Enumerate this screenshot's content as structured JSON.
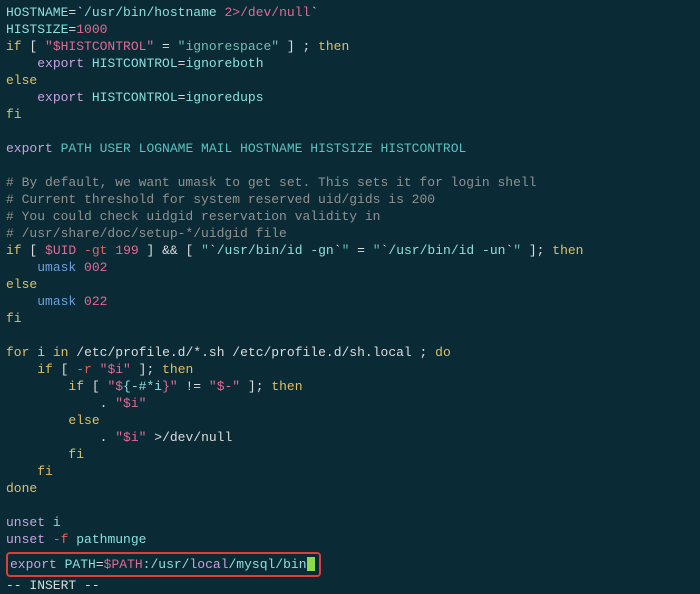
{
  "l1_hostname": "HOSTNAME",
  "l1_eq": "=",
  "l1_bq": "`",
  "l1_path": "/usr/bin/hostname ",
  "l1_dev": "2>/dev/null",
  "l1_bq2": "`",
  "l2_histsize": "HISTSIZE",
  "l2_eq": "=",
  "l2_val": "1000",
  "l3_if": "if",
  "l3_br1": " [ ",
  "l3_var": "\"$HISTCONTROL\"",
  "l3_eq": " = ",
  "l3_str": "\"ignorespace\"",
  "l3_br2": " ] ; ",
  "l3_then": "then",
  "l4_pad": "    ",
  "l4_export": "export",
  "l4_sp": " ",
  "l4_var": "HISTCONTROL",
  "l4_eq": "=",
  "l4_val": "ignoreboth",
  "l5_else": "else",
  "l6_pad": "    ",
  "l6_export": "export",
  "l6_sp": " ",
  "l6_var": "HISTCONTROL",
  "l6_eq": "=",
  "l6_val": "ignoredups",
  "l7_fi": "fi",
  "l9_export": "export",
  "l9_sp": " ",
  "l9_list": "PATH USER LOGNAME MAIL HOSTNAME HISTSIZE HISTCONTROL",
  "c1": "# By default, we want umask to get set. This sets it for login shell",
  "c2": "# Current threshold for system reserved uid/gids is 200",
  "c3": "# You could check uidgid reservation validity in",
  "c4": "# /usr/share/doc/setup-*/uidgid file",
  "u1_if": "if",
  "u1_br1": " [ ",
  "u1_uid": "$UID",
  "u1_sp": " ",
  "u1_gt": "-gt",
  "u1_sp2": " ",
  "u1_num": "199",
  "u1_br2": " ] ",
  "u1_amp": "&&",
  "u1_br3": " [ ",
  "u1_q1": "\"",
  "u1_bq1": "`",
  "u1_cmd1": "/usr/bin/id -gn",
  "u1_bq2": "`",
  "u1_q2": "\"",
  "u1_eq": " = ",
  "u1_q3": "\"",
  "u1_bq3": "`",
  "u1_cmd2": "/usr/bin/id -un",
  "u1_bq4": "`",
  "u1_q4": "\"",
  "u1_br4": " ]; ",
  "u1_then": "then",
  "u2_pad": "    ",
  "u2_umask": "umask",
  "u2_sp": " ",
  "u2_val": "002",
  "u3_else": "else",
  "u4_pad": "    ",
  "u4_umask": "umask",
  "u4_sp": " ",
  "u4_val": "022",
  "u5_fi": "fi",
  "f1_for": "for",
  "f1_sp": " ",
  "f1_i": "i",
  "f1_sp2": " ",
  "f1_in": "in",
  "f1_sp3": " ",
  "f1_paths": "/etc/profile.d/*.sh /etc/profile.d/sh.local",
  "f1_sp4": " ; ",
  "f1_do": "do",
  "f2_pad": "    ",
  "f2_if": "if",
  "f2_br1": " [ ",
  "f2_r": "-r",
  "f2_sp": " ",
  "f2_var": "\"$i\"",
  "f2_br2": " ]; ",
  "f2_then": "then",
  "f3_pad": "        ",
  "f3_if": "if",
  "f3_br1": " [ ",
  "f3_s1a": "\"$",
  "f3_core": "{-#*i",
  "f3_s1b": "}\"",
  "f3_neq": " != ",
  "f3_s2": "\"$-\"",
  "f3_br2": " ]; ",
  "f3_then": "then",
  "f4_pad": "            . ",
  "f4_var": "\"$i\"",
  "f5_pad": "        ",
  "f5_else": "else",
  "f6_pad": "            . ",
  "f6_var": "\"$i\"",
  "f6_sp": " ",
  "f6_gt": ">",
  "f6_dev": "/dev/null",
  "f7_pad": "        ",
  "f7_fi": "fi",
  "f8_pad": "    ",
  "f8_fi": "fi",
  "f9_done": "done",
  "us1_unset": "unset",
  "us1_sp": " ",
  "us1_i": "i",
  "us2_unset": "unset",
  "us2_sp": " ",
  "us2_f": "-f",
  "us2_sp2": " ",
  "us2_pm": "pathmunge",
  "hl_export": "export",
  "hl_sp": " ",
  "hl_path": "PATH",
  "hl_eq": "=",
  "hl_var": "$PATH",
  "hl_s1": ":/usr/",
  "hl_local": "local",
  "hl_s2": "/mysql/bin",
  "mode": "-- INSERT --"
}
